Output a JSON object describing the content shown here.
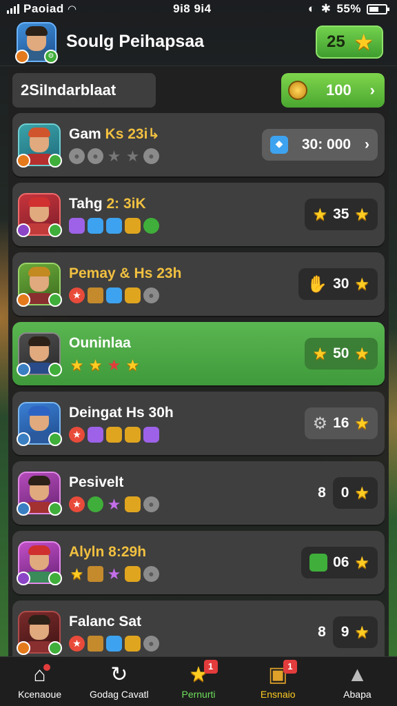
{
  "status_bar": {
    "carrier": "Paoiad",
    "time": "9i8 9i4",
    "battery": "55%"
  },
  "header": {
    "title": "Soulg Peihapsaa",
    "stars": "25"
  },
  "summary": {
    "label": "2SiIndarblaat",
    "coins": "100"
  },
  "rows": [
    {
      "name": "Gam",
      "timer": "Ks 23i↳",
      "right_value": "30: 000",
      "right_type": "gems"
    },
    {
      "name": "Tahg",
      "timer": "2: 3iK",
      "right_value": "35",
      "right_type": "stars"
    },
    {
      "name": "Pemay & Hs 23h",
      "timer": "",
      "right_value": "30",
      "right_type": "hand"
    },
    {
      "name": "Ouninlaa",
      "timer": "",
      "right_value": "50",
      "right_type": "stars"
    },
    {
      "name": "Deingat",
      "timer": "Hs 30h",
      "right_value": "16",
      "right_type": "gear"
    },
    {
      "name": "Pesivelt",
      "timer": "",
      "right_prefix": "8",
      "right_value": "0",
      "right_type": "plain"
    },
    {
      "name": "Alyln 8:29h",
      "timer": "",
      "right_value": "06",
      "right_type": "cube"
    },
    {
      "name": "Falanc Sat",
      "timer": "",
      "right_prefix": "8",
      "right_value": "9",
      "right_type": "plain"
    }
  ],
  "tabs": [
    {
      "label": "Kcenaoue",
      "icon": "home-icon"
    },
    {
      "label": "Godag Cavatl",
      "icon": "rotate-icon"
    },
    {
      "label": "Pernurti",
      "icon": "star-icon",
      "badge": "1"
    },
    {
      "label": "Ensnaio",
      "icon": "chest-icon",
      "badge": "1"
    },
    {
      "label": "Abapa",
      "icon": "person-icon"
    }
  ],
  "colors": {
    "accent_green": "#4aa630",
    "star_gold": "#ffcc22",
    "row_bg": "#3f3f3f"
  }
}
